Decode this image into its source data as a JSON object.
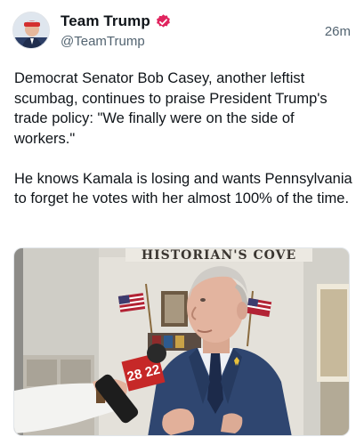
{
  "post": {
    "author": {
      "display_name": "Team Trump",
      "handle": "@TeamTrump",
      "verified_icon": "verified-badge-icon",
      "verified_color": "#e0245e"
    },
    "timestamp": "26m",
    "body": {
      "paragraph_1": "Democrat Senator Bob Casey, another leftist scumbag, continues to praise President Trump's trade policy: \"We finally were on the side of workers.\"",
      "paragraph_2": "He knows Kamala is losing and wants Pennsylvania to forget he votes with her almost 100% of the time."
    },
    "media": {
      "sign_text": "HISTORIAN'S COVE",
      "mic_flag_text": "28 22"
    }
  },
  "colors": {
    "text_primary": "#0f1419",
    "text_secondary": "#536471",
    "badge": "#e0245e"
  }
}
